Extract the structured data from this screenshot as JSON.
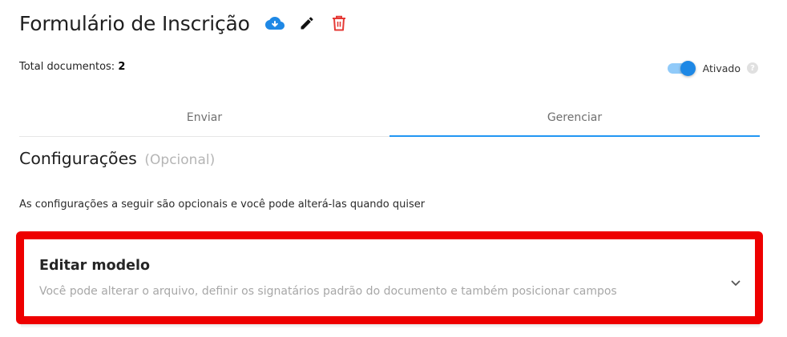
{
  "header": {
    "title": "Formulário de Inscrição",
    "actions": {
      "download_icon": "cloud-download-icon",
      "edit_icon": "pencil-icon",
      "delete_icon": "trash-icon"
    }
  },
  "summary": {
    "total_label": "Total documentos:",
    "total_value": "2"
  },
  "status_toggle": {
    "label": "Ativado",
    "enabled": true,
    "help_icon": "help-circle-icon"
  },
  "tabs": [
    {
      "label": "Enviar",
      "active": false
    },
    {
      "label": "Gerenciar",
      "active": true
    }
  ],
  "section": {
    "title": "Configurações",
    "optional": "(Opcional)",
    "description": "As configurações a seguir são opcionais e você pode alterá-las quando quiser"
  },
  "card": {
    "title": "Editar modelo",
    "description": "Você pode alterar o arquivo, definir os signatários padrão do documento e também posicionar campos",
    "expand_icon": "chevron-down-icon"
  },
  "colors": {
    "accent": "#2196f3",
    "cloud_icon": "#1e88e5",
    "delete_icon": "#e53935",
    "highlight_border": "#ee0000"
  }
}
